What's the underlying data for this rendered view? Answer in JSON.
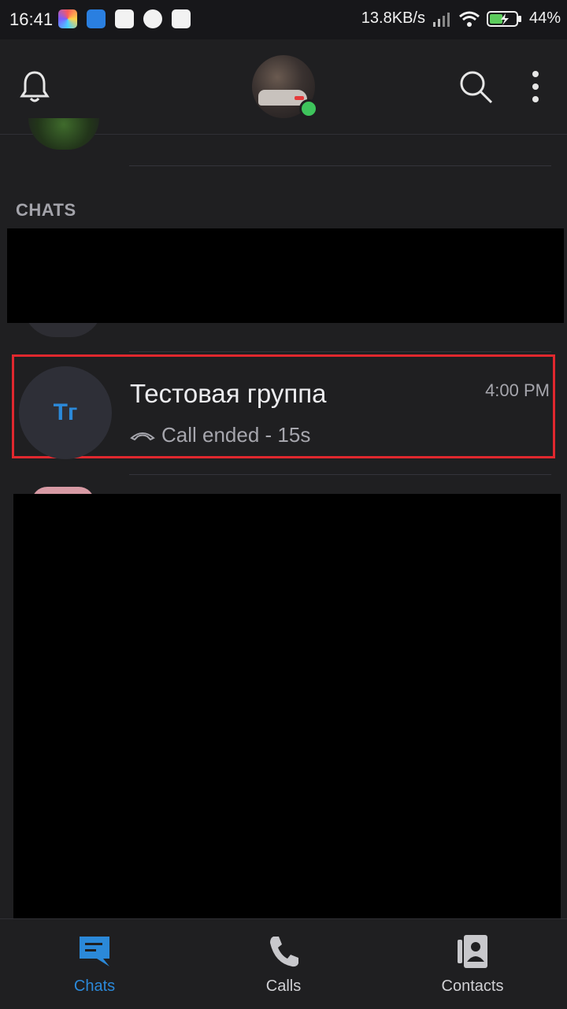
{
  "status_bar": {
    "time": "16:41",
    "network_speed": "13.8KB/s",
    "battery_percent": "44%"
  },
  "header": {
    "bell_icon": "bell-icon",
    "search_icon": "search-icon",
    "more_icon": "more-vertical-icon",
    "presence_color": "#3ec45c"
  },
  "section": {
    "chats_label": "CHATS"
  },
  "chats": [
    {
      "avatar_initials": "Тг",
      "title": "Тестовая группа",
      "time": "4:00 PM",
      "preview": "Call ended - 15s",
      "preview_icon": "phone-hangup-icon"
    }
  ],
  "bottom_nav": {
    "items": [
      {
        "label": "Chats",
        "icon": "chat-icon",
        "active": true
      },
      {
        "label": "Calls",
        "icon": "phone-icon",
        "active": false
      },
      {
        "label": "Contacts",
        "icon": "contacts-icon",
        "active": false
      }
    ]
  },
  "colors": {
    "accent": "#2b89d9",
    "highlight_border": "#e0282e",
    "background": "#1f1f21"
  }
}
